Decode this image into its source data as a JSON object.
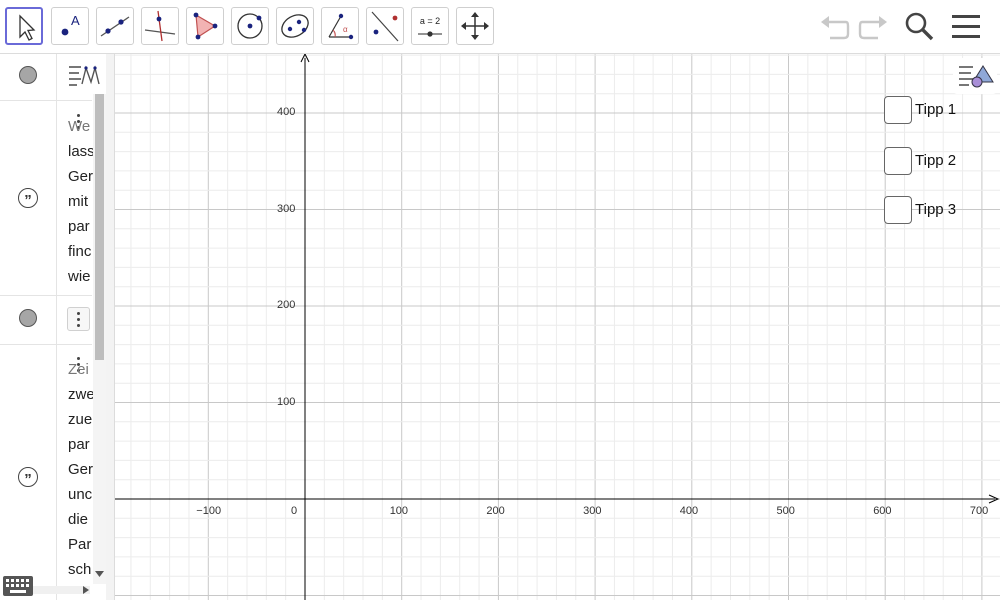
{
  "toolbar": {
    "tools": [
      {
        "name": "move-tool",
        "icon": "arrow-pointer-icon",
        "active": true
      },
      {
        "name": "point-tool",
        "icon": "point-icon"
      },
      {
        "name": "line-tool",
        "icon": "line-icon"
      },
      {
        "name": "perpendicular-tool",
        "icon": "perpendicular-line-icon"
      },
      {
        "name": "polygon-tool",
        "icon": "polygon-icon"
      },
      {
        "name": "circle-tool",
        "icon": "circle-icon"
      },
      {
        "name": "conic-tool",
        "icon": "ellipse-icon"
      },
      {
        "name": "angle-tool",
        "icon": "angle-icon"
      },
      {
        "name": "reflect-tool",
        "icon": "reflect-icon"
      },
      {
        "name": "slider-tool",
        "icon": "slider-icon",
        "label": "a = 2"
      },
      {
        "name": "move-graphics-tool",
        "icon": "move-arrows-icon"
      }
    ],
    "undo_icon": "undo-icon",
    "redo_icon": "redo-icon",
    "search_icon": "search-icon",
    "menu_icon": "hamburger-menu-icon"
  },
  "algebra": {
    "style_bar_icon": "algebra-style-bar-icon",
    "text1_lines": [
      "We",
      "lass",
      "Ger",
      "mit",
      "par",
      "finc",
      "wie"
    ],
    "text2_lines": [
      "Zei",
      "zwe",
      "zue",
      "par",
      "Ger",
      "unc",
      "die",
      "Par",
      "sch"
    ],
    "keyboard_icon": "keyboard-icon"
  },
  "graphics": {
    "style_bar_icon": "graphics-style-bar-icon",
    "x_ticks": [
      "−100",
      "0",
      "100",
      "200",
      "300",
      "400",
      "500",
      "600",
      "700"
    ],
    "y_ticks": [
      "100",
      "200",
      "300",
      "400"
    ],
    "checkboxes": [
      {
        "label": "Tipp 1",
        "checked": false
      },
      {
        "label": "Tipp 2",
        "checked": false
      },
      {
        "label": "Tipp 3",
        "checked": false
      }
    ]
  },
  "colors": {
    "accent": "#6a6ad8",
    "grid_major": "#c8c8c8",
    "grid_minor": "#ececec",
    "axis": "#000000"
  }
}
